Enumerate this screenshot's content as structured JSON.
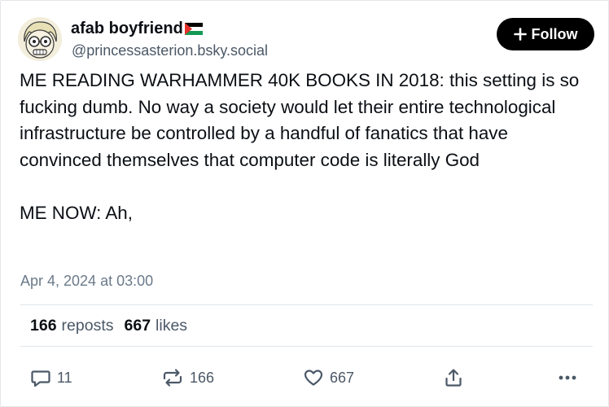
{
  "author": {
    "display_name": "afab boyfriend",
    "handle": "@princessasterion.bsky.social",
    "avatar_icon": "cartoon-face-avatar",
    "flag_icon": "palestine-flag-icon"
  },
  "follow_button": {
    "label": "Follow",
    "icon": "plus-icon"
  },
  "post": {
    "text": "ME READING WARHAMMER 40K BOOKS IN 2018: this setting is so fucking dumb. No way a society would let their entire technological infrastructure be controlled by a handful of fanatics that have convinced themselves that computer code is literally God\n\nME NOW: Ah,",
    "timestamp": "Apr 4, 2024 at 03:00"
  },
  "stats": {
    "reposts_count": "166",
    "reposts_label": "reposts",
    "likes_count": "667",
    "likes_label": "likes"
  },
  "actions": {
    "reply_count": "11",
    "repost_count": "166",
    "like_count": "667"
  },
  "colors": {
    "text": "#0b0f14",
    "muted": "#4b5867",
    "timestamp": "#6b7a8a",
    "button_bg": "#000000",
    "divider": "#e1e5ea"
  }
}
